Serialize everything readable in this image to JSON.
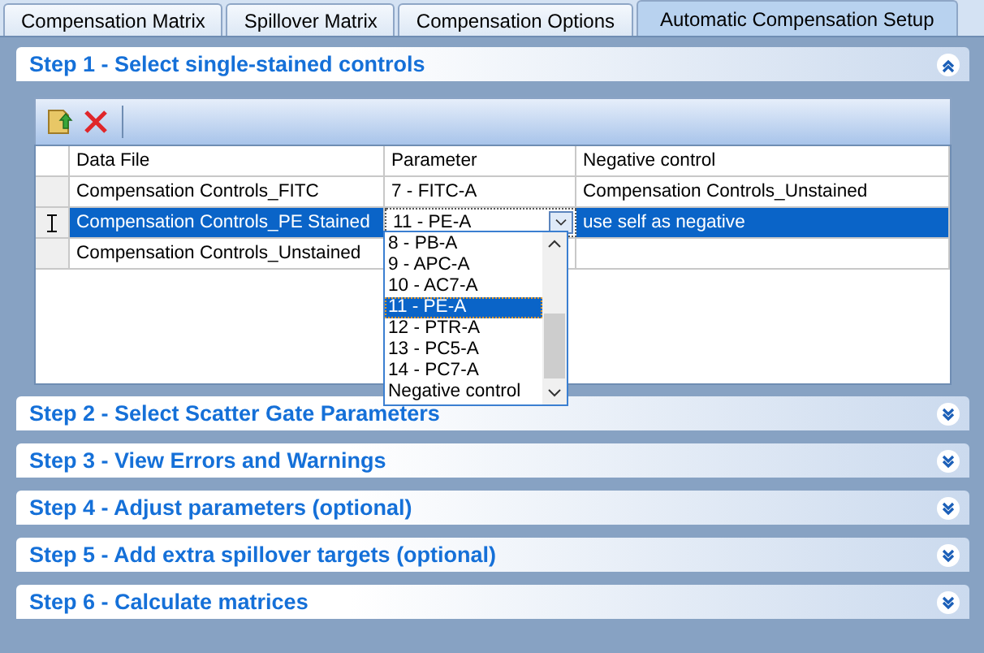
{
  "tabs": [
    {
      "label": "Compensation Matrix",
      "selected": false
    },
    {
      "label": "Spillover Matrix",
      "selected": false
    },
    {
      "label": "Compensation Options",
      "selected": false
    },
    {
      "label": "Automatic Compensation Setup",
      "selected": true
    }
  ],
  "steps": [
    {
      "title": "Step 1 - Select single-stained controls",
      "expanded": true
    },
    {
      "title": "Step 2 - Select Scatter Gate Parameters",
      "expanded": false
    },
    {
      "title": "Step 3 - View Errors and Warnings",
      "expanded": false
    },
    {
      "title": "Step 4 - Adjust parameters (optional)",
      "expanded": false
    },
    {
      "title": "Step 5 - Add extra spillover targets (optional)",
      "expanded": false
    },
    {
      "title": "Step 6 - Calculate matrices",
      "expanded": false
    }
  ],
  "grid": {
    "columns": [
      "Data File",
      "Parameter",
      "Negative control"
    ],
    "rows": [
      {
        "cells": [
          "Compensation Controls_FITC",
          "7 - FITC-A",
          "Compensation Controls_Unstained"
        ],
        "selected": false
      },
      {
        "cells": [
          "Compensation Controls_PE Stained",
          "11 - PE-A",
          "use self as negative"
        ],
        "selected": true
      },
      {
        "cells": [
          "Compensation Controls_Unstained"
        ],
        "selected": false
      }
    ]
  },
  "dropdown": {
    "items": [
      {
        "label": "8 - PB-A",
        "selected": false
      },
      {
        "label": "9 - APC-A",
        "selected": false
      },
      {
        "label": "10 - AC7-A",
        "selected": false
      },
      {
        "label": "11 - PE-A",
        "selected": true
      },
      {
        "label": "12 - PTR-A",
        "selected": false
      },
      {
        "label": "13 - PC5-A",
        "selected": false
      },
      {
        "label": "14 - PC7-A",
        "selected": false
      },
      {
        "label": "Negative control",
        "selected": false
      }
    ]
  }
}
